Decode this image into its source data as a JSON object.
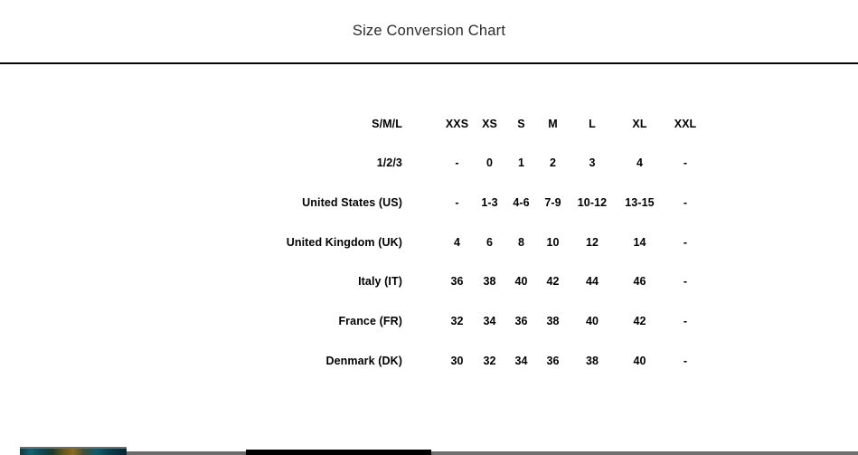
{
  "header": {
    "title": "Size Conversion Chart"
  },
  "table": {
    "column_headers": [
      "XXS",
      "XS",
      "S",
      "M",
      "L",
      "XL",
      "XXL"
    ],
    "header_label": "S/M/L",
    "rows": [
      {
        "label": "1/2/3",
        "values": [
          "-",
          "0",
          "1",
          "2",
          "3",
          "4",
          "-"
        ]
      },
      {
        "label": "United States (US)",
        "values": [
          "-",
          "1-3",
          "4-6",
          "7-9",
          "10-12",
          "13-15",
          "-"
        ]
      },
      {
        "label": "United Kingdom (UK)",
        "values": [
          "4",
          "6",
          "8",
          "10",
          "12",
          "14",
          "-"
        ]
      },
      {
        "label": "Italy (IT)",
        "values": [
          "36",
          "38",
          "40",
          "42",
          "44",
          "46",
          "-"
        ]
      },
      {
        "label": "France (FR)",
        "values": [
          "32",
          "34",
          "36",
          "38",
          "40",
          "42",
          "-"
        ]
      },
      {
        "label": "Denmark (DK)",
        "values": [
          "30",
          "32",
          "34",
          "36",
          "38",
          "40",
          "-"
        ]
      }
    ]
  },
  "colors": {
    "background": "#ffffff",
    "text": "#000000",
    "title_text": "#2b2b2b",
    "divider": "#050505",
    "strip_gray": "#6e6e6e",
    "strip_black": "#000000"
  }
}
